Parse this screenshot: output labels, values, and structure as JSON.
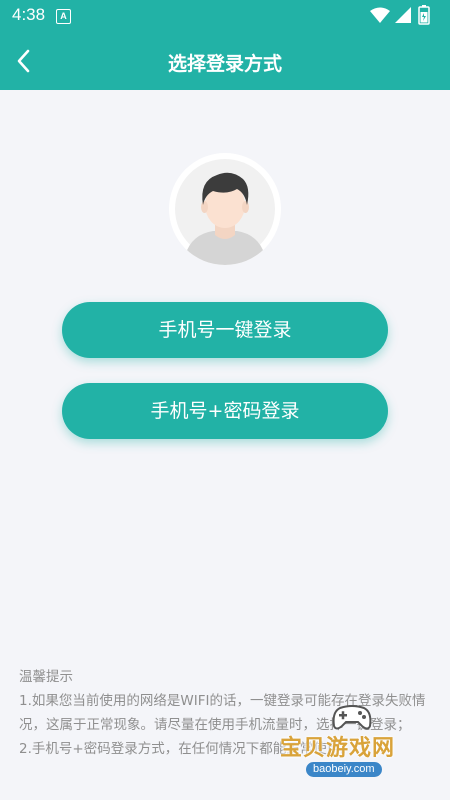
{
  "status_bar": {
    "time": "4:38",
    "notification_icon": "a-box-icon",
    "icons": [
      "wifi-icon",
      "signal-icon",
      "battery-icon"
    ]
  },
  "header": {
    "back_icon": "chevron-left-icon",
    "title": "选择登录方式"
  },
  "avatar": {
    "icon": "default-user-avatar"
  },
  "buttons": {
    "one_key_login": "手机号一键登录",
    "password_login": "手机号+密码登录"
  },
  "tips": {
    "title": "温馨提示",
    "line1": "1.如果您当前使用的网络是WIFI的话，一键登录可能存在登录失败情况，这属于正常现象。请尽量在使用手机流量时，选择一键登录；",
    "line2": "2.手机号+密码登录方式，在任何情况下都能正常使用。"
  },
  "watermark": {
    "text": "宝贝游戏网",
    "url": "baobeiy.com"
  },
  "colors": {
    "primary": "#22b2a6",
    "background": "#f4f5f9",
    "tip_text": "#8f8f8f"
  }
}
